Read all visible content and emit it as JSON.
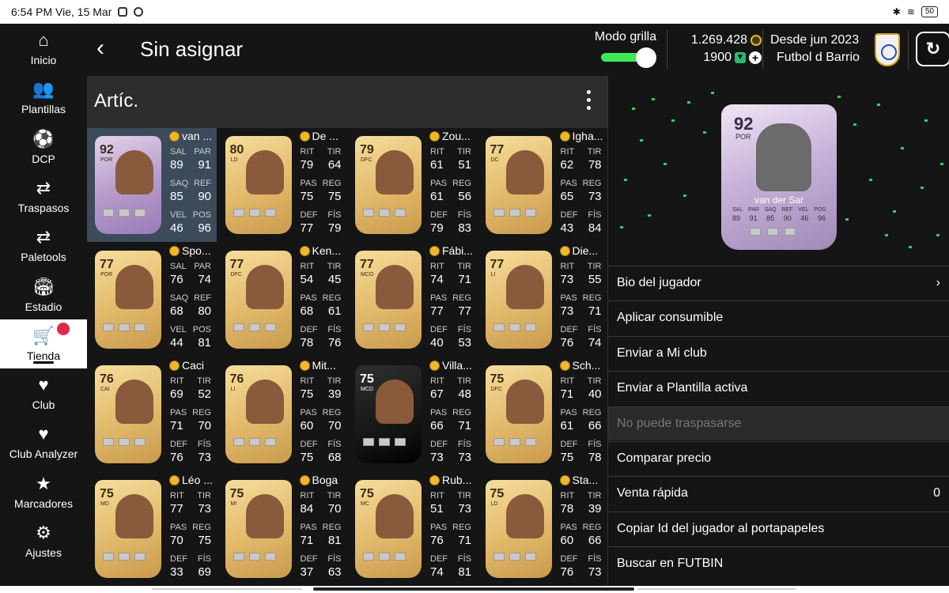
{
  "statusbar": {
    "time": "6:54 PM Vie, 15 Mar",
    "battery": "50"
  },
  "nav": [
    {
      "label": "Inicio",
      "icon": "⌂",
      "name": "home-icon"
    },
    {
      "label": "Plantillas",
      "icon": "👥",
      "name": "squads-icon"
    },
    {
      "label": "DCP",
      "icon": "⚽",
      "name": "dcp-icon"
    },
    {
      "label": "Traspasos",
      "icon": "⇄",
      "name": "transfers-icon"
    },
    {
      "label": "Paletools",
      "icon": "⇄",
      "name": "paletools-icon"
    },
    {
      "label": "Estadio",
      "icon": "🏟",
      "name": "stadium-icon"
    },
    {
      "label": "Tienda",
      "icon": "🛒",
      "name": "cart-icon"
    },
    {
      "label": "Club",
      "icon": "♥",
      "name": "club-icon"
    },
    {
      "label": "Club Analyzer",
      "icon": "♥",
      "name": "club-analyzer-icon"
    },
    {
      "label": "Marcadores",
      "icon": "★",
      "name": "leaderboards-icon"
    },
    {
      "label": "Ajustes",
      "icon": "⚙",
      "name": "settings-icon"
    }
  ],
  "header": {
    "back": "‹",
    "title": "Sin asignar",
    "grid_mode_label": "Modo grilla",
    "coins": "1.269.428",
    "points": "1900",
    "since": "Desde jun 2023",
    "club_name": "Futbol d Barrio"
  },
  "list": {
    "title": "Artíc."
  },
  "players": [
    {
      "name": "van ...",
      "rating": "92",
      "pos": "POR",
      "card": "icon",
      "labels": [
        "SAL",
        "PAR",
        "SAQ",
        "REF",
        "VEL",
        "POS"
      ],
      "values": [
        "89",
        "91",
        "85",
        "90",
        "46",
        "96"
      ]
    },
    {
      "name": "De ...",
      "rating": "80",
      "pos": "LD",
      "card": "gold",
      "labels": [
        "RIT",
        "TIR",
        "PAS",
        "REG",
        "DEF",
        "FÍS"
      ],
      "values": [
        "79",
        "64",
        "75",
        "75",
        "77",
        "79"
      ]
    },
    {
      "name": "Zou...",
      "rating": "79",
      "pos": "DFC",
      "card": "gold",
      "labels": [
        "RIT",
        "TIR",
        "PAS",
        "REG",
        "DEF",
        "FÍS"
      ],
      "values": [
        "61",
        "51",
        "61",
        "56",
        "79",
        "83"
      ]
    },
    {
      "name": "Igha...",
      "rating": "77",
      "pos": "DC",
      "card": "gold",
      "labels": [
        "RIT",
        "TIR",
        "PAS",
        "REG",
        "DEF",
        "FÍS"
      ],
      "values": [
        "62",
        "78",
        "65",
        "73",
        "43",
        "84"
      ]
    },
    {
      "name": "Spo...",
      "rating": "77",
      "pos": "POR",
      "card": "gold",
      "labels": [
        "SAL",
        "PAR",
        "SAQ",
        "REF",
        "VEL",
        "POS"
      ],
      "values": [
        "76",
        "74",
        "68",
        "80",
        "44",
        "81"
      ]
    },
    {
      "name": "Ken...",
      "rating": "77",
      "pos": "DFC",
      "card": "gold",
      "labels": [
        "RIT",
        "TIR",
        "PAS",
        "REG",
        "DEF",
        "FÍS"
      ],
      "values": [
        "54",
        "45",
        "68",
        "61",
        "78",
        "76"
      ]
    },
    {
      "name": "Fábi...",
      "rating": "77",
      "pos": "MCO",
      "card": "gold",
      "labels": [
        "RIT",
        "TIR",
        "PAS",
        "REG",
        "DEF",
        "FÍS"
      ],
      "values": [
        "74",
        "71",
        "77",
        "77",
        "40",
        "53"
      ]
    },
    {
      "name": "Die...",
      "rating": "77",
      "pos": "LI",
      "card": "gold",
      "labels": [
        "RIT",
        "TIR",
        "PAS",
        "REG",
        "DEF",
        "FÍS"
      ],
      "values": [
        "73",
        "55",
        "73",
        "71",
        "76",
        "74"
      ]
    },
    {
      "name": "Caci",
      "rating": "76",
      "pos": "CAI",
      "card": "gold",
      "labels": [
        "RIT",
        "TIR",
        "PAS",
        "REG",
        "DEF",
        "FÍS"
      ],
      "values": [
        "69",
        "52",
        "71",
        "70",
        "76",
        "73"
      ]
    },
    {
      "name": "Mit...",
      "rating": "76",
      "pos": "LI",
      "card": "gold",
      "labels": [
        "RIT",
        "TIR",
        "PAS",
        "REG",
        "DEF",
        "FÍS"
      ],
      "values": [
        "75",
        "39",
        "60",
        "70",
        "75",
        "68"
      ]
    },
    {
      "name": "Villa...",
      "rating": "75",
      "pos": "MCD",
      "card": "black",
      "labels": [
        "RIT",
        "TIR",
        "PAS",
        "REG",
        "DEF",
        "FÍS"
      ],
      "values": [
        "67",
        "48",
        "66",
        "71",
        "73",
        "73"
      ]
    },
    {
      "name": "Sch...",
      "rating": "75",
      "pos": "DFC",
      "card": "gold",
      "labels": [
        "RIT",
        "TIR",
        "PAS",
        "REG",
        "DEF",
        "FÍS"
      ],
      "values": [
        "71",
        "40",
        "61",
        "66",
        "75",
        "78"
      ]
    },
    {
      "name": "Léo ...",
      "rating": "75",
      "pos": "MD",
      "card": "gold",
      "labels": [
        "RIT",
        "TIR",
        "PAS",
        "REG",
        "DEF",
        "FÍS"
      ],
      "values": [
        "77",
        "73",
        "70",
        "75",
        "33",
        "69"
      ]
    },
    {
      "name": "Boga",
      "rating": "75",
      "pos": "MI",
      "card": "gold",
      "labels": [
        "RIT",
        "TIR",
        "PAS",
        "REG",
        "DEF",
        "FÍS"
      ],
      "values": [
        "84",
        "70",
        "71",
        "81",
        "37",
        "63"
      ]
    },
    {
      "name": "Rub...",
      "rating": "75",
      "pos": "MC",
      "card": "gold",
      "labels": [
        "RIT",
        "TIR",
        "PAS",
        "REG",
        "DEF",
        "FÍS"
      ],
      "values": [
        "51",
        "73",
        "76",
        "71",
        "74",
        "81"
      ]
    },
    {
      "name": "Sta...",
      "rating": "75",
      "pos": "LD",
      "card": "gold",
      "labels": [
        "RIT",
        "TIR",
        "PAS",
        "REG",
        "DEF",
        "FÍS"
      ],
      "values": [
        "78",
        "39",
        "60",
        "66",
        "76",
        "73"
      ]
    }
  ],
  "detail": {
    "rating": "92",
    "position": "POR",
    "name": "van der Sar",
    "stat_labels": [
      "SAL",
      "PAR",
      "SAQ",
      "REF",
      "VEL",
      "POS"
    ],
    "stat_values": [
      "89",
      "91",
      "85",
      "90",
      "46",
      "96"
    ]
  },
  "menu": [
    {
      "label": "Bio del jugador",
      "right": "›",
      "disabled": false
    },
    {
      "label": "Aplicar consumible",
      "right": "",
      "disabled": false
    },
    {
      "label": "Enviar a Mi club",
      "right": "",
      "disabled": false
    },
    {
      "label": "Enviar a Plantilla activa",
      "right": "",
      "disabled": false
    },
    {
      "label": "No puede traspasarse",
      "right": "",
      "disabled": true
    },
    {
      "label": "Comparar precio",
      "right": "",
      "disabled": false
    },
    {
      "label": "Venta rápida",
      "right": "0",
      "disabled": false
    },
    {
      "label": "Copiar Id del jugador al portapapeles",
      "right": "",
      "disabled": false
    },
    {
      "label": "Buscar en FUTBIN",
      "right": "",
      "disabled": false
    }
  ],
  "colors": {
    "accent_green": "#3dea56",
    "notification": "#e0284b",
    "chem": "#f0b72a",
    "accent_green_dash": "#2bd05c"
  }
}
